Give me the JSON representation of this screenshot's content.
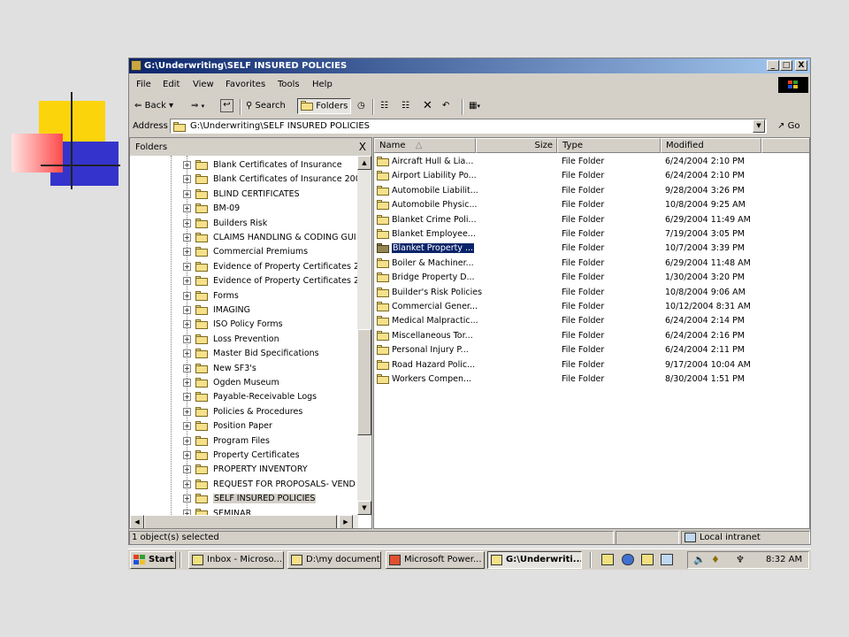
{
  "window": {
    "title": "G:\\Underwriting\\SELF INSURED POLICIES",
    "caption_buttons": [
      "_",
      "□",
      "X"
    ]
  },
  "menu": [
    "File",
    "Edit",
    "View",
    "Favorites",
    "Tools",
    "Help"
  ],
  "toolbar": {
    "back": "Back",
    "search": "Search",
    "folders": "Folders"
  },
  "address": {
    "label": "Address",
    "value": "G:\\Underwriting\\SELF INSURED POLICIES",
    "go": "Go"
  },
  "folders_pane": {
    "title": "Folders",
    "close": "X",
    "items": [
      {
        "label": "Blank Certificates of Insurance"
      },
      {
        "label": "Blank Certificates of Insurance 200"
      },
      {
        "label": "BLIND CERTIFICATES"
      },
      {
        "label": "BM-09"
      },
      {
        "label": "Builders Risk"
      },
      {
        "label": "CLAIMS HANDLING & CODING GUI"
      },
      {
        "label": "Commercial Premiums"
      },
      {
        "label": "Evidence of Property Certificates 2"
      },
      {
        "label": "Evidence of Property Certificates 2"
      },
      {
        "label": "Forms"
      },
      {
        "label": "IMAGING"
      },
      {
        "label": "ISO Policy Forms"
      },
      {
        "label": "Loss Prevention"
      },
      {
        "label": "Master Bid Specifications"
      },
      {
        "label": "New SF3's"
      },
      {
        "label": "Ogden Museum"
      },
      {
        "label": "Payable-Receivable Logs"
      },
      {
        "label": "Policies & Procedures"
      },
      {
        "label": "Position Paper"
      },
      {
        "label": "Program Files"
      },
      {
        "label": "Property Certificates"
      },
      {
        "label": "PROPERTY INVENTORY"
      },
      {
        "label": "REQUEST FOR PROPOSALS- VEND"
      },
      {
        "label": "SELF INSURED POLICIES",
        "selected": true
      },
      {
        "label": "SEMINAR"
      }
    ]
  },
  "file_list": {
    "columns": {
      "name": "Name",
      "size": "Size",
      "type": "Type",
      "modified": "Modified"
    },
    "rows": [
      {
        "name": "Aircraft Hull & Lia...",
        "type": "File Folder",
        "modified": "6/24/2004 2:10 PM"
      },
      {
        "name": "Airport Liability Po...",
        "type": "File Folder",
        "modified": "6/24/2004 2:10 PM"
      },
      {
        "name": "Automobile Liabilit...",
        "type": "File Folder",
        "modified": "9/28/2004 3:26 PM"
      },
      {
        "name": "Automobile Physic...",
        "type": "File Folder",
        "modified": "10/8/2004 9:25 AM"
      },
      {
        "name": "Blanket Crime Poli...",
        "type": "File Folder",
        "modified": "6/29/2004 11:49 AM"
      },
      {
        "name": "Blanket Employee...",
        "type": "File Folder",
        "modified": "7/19/2004 3:05 PM"
      },
      {
        "name": "Blanket Property ...",
        "type": "File Folder",
        "modified": "10/7/2004 3:39 PM",
        "selected": true
      },
      {
        "name": "Boiler & Machiner...",
        "type": "File Folder",
        "modified": "6/29/2004 11:48 AM"
      },
      {
        "name": "Bridge Property D...",
        "type": "File Folder",
        "modified": "1/30/2004 3:20 PM"
      },
      {
        "name": "Builder's Risk Policies",
        "type": "File Folder",
        "modified": "10/8/2004 9:06 AM"
      },
      {
        "name": "Commercial Gener...",
        "type": "File Folder",
        "modified": "10/12/2004 8:31 AM"
      },
      {
        "name": "Medical Malpractic...",
        "type": "File Folder",
        "modified": "6/24/2004 2:14 PM"
      },
      {
        "name": "Miscellaneous Tor...",
        "type": "File Folder",
        "modified": "6/24/2004 2:16 PM"
      },
      {
        "name": "Personal Injury P...",
        "type": "File Folder",
        "modified": "6/24/2004 2:11 PM"
      },
      {
        "name": "Road Hazard Polic...",
        "type": "File Folder",
        "modified": "9/17/2004 10:04 AM"
      },
      {
        "name": "Workers Compen...",
        "type": "File Folder",
        "modified": "8/30/2004 1:51 PM"
      }
    ]
  },
  "status": {
    "selection": "1 object(s) selected",
    "zone": "Local intranet"
  },
  "taskbar": {
    "start": "Start",
    "buttons": [
      {
        "label": "Inbox - Microso..."
      },
      {
        "label": "D:\\my documents"
      },
      {
        "label": "Microsoft Power..."
      },
      {
        "label": "G:\\Underwriti...",
        "active": true
      }
    ],
    "clock": "8:32 AM"
  },
  "colors": {
    "title_start": "#0a246a",
    "title_end": "#a6caf0",
    "selection": "#0a246a",
    "face": "#d4d0c8"
  }
}
